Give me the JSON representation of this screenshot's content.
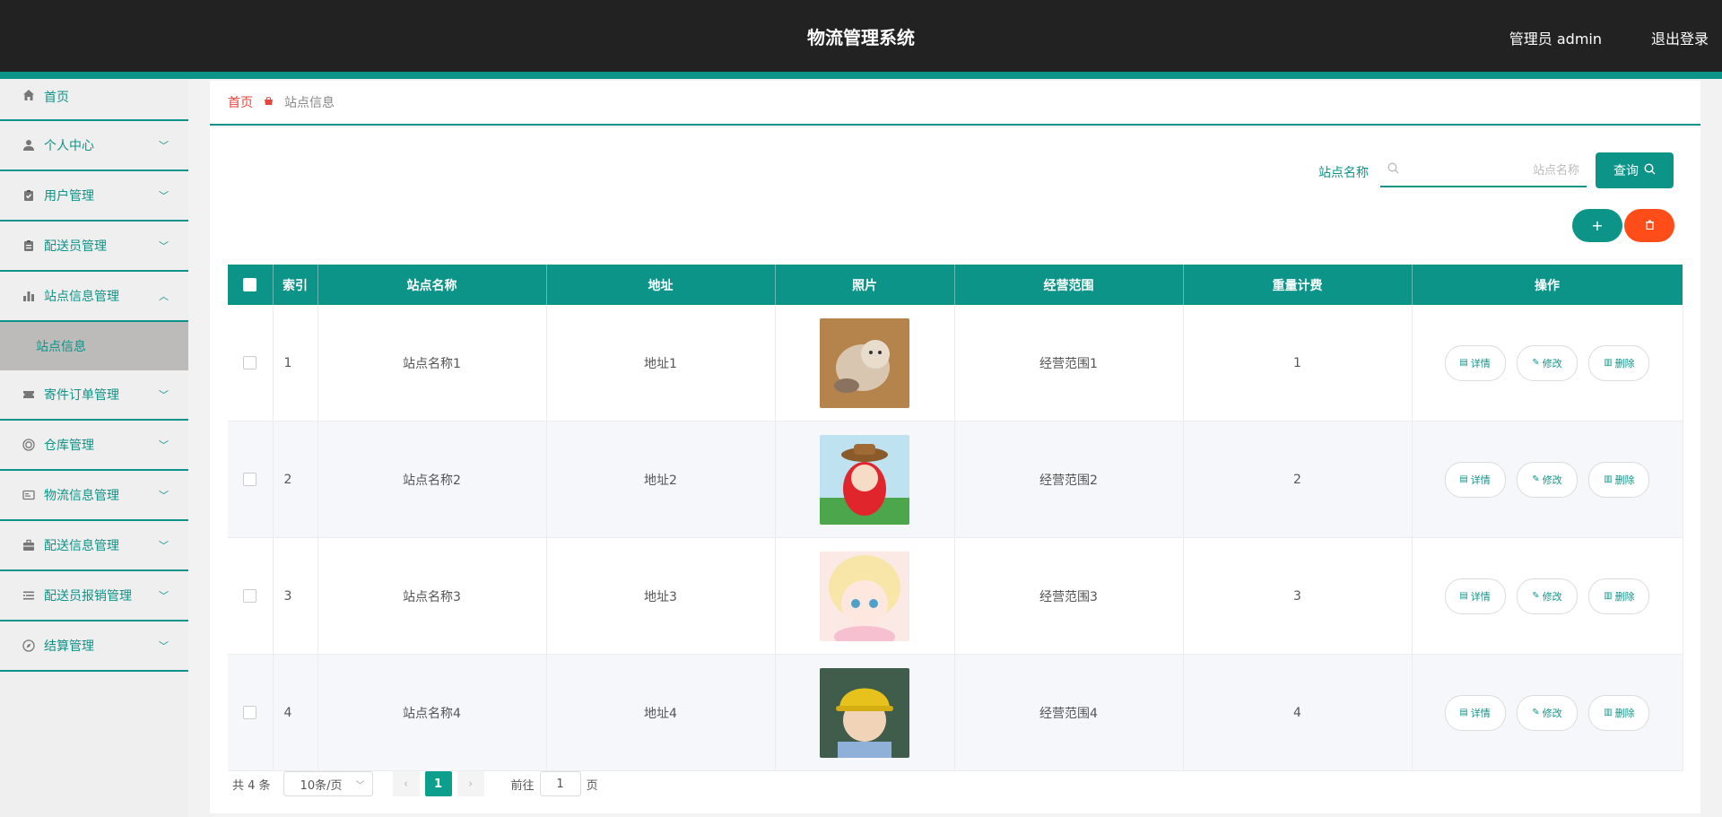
{
  "header": {
    "title": "物流管理系统",
    "user": "管理员 admin",
    "logout": "退出登录"
  },
  "sidebar": {
    "items": [
      {
        "label": "首页",
        "icon": "home-icon"
      },
      {
        "label": "个人中心",
        "icon": "user-icon"
      },
      {
        "label": "用户管理",
        "icon": "clipboard-check-icon"
      },
      {
        "label": "配送员管理",
        "icon": "clipboard-icon"
      },
      {
        "label": "站点信息管理",
        "icon": "bar-chart-icon"
      },
      {
        "label": "寄件订单管理",
        "icon": "ticket-icon"
      },
      {
        "label": "仓库管理",
        "icon": "target-icon"
      },
      {
        "label": "物流信息管理",
        "icon": "postcard-icon"
      },
      {
        "label": "配送信息管理",
        "icon": "briefcase-icon"
      },
      {
        "label": "配送员报销管理",
        "icon": "list-icon"
      },
      {
        "label": "结算管理",
        "icon": "compass-icon"
      }
    ],
    "sub_item": "站点信息"
  },
  "breadcrumb": {
    "home": "首页",
    "current": "站点信息"
  },
  "search": {
    "label": "站点名称",
    "placeholder": "站点名称",
    "query_label": "查询"
  },
  "actions": {
    "add_symbol": "+"
  },
  "table": {
    "headers": [
      "索引",
      "站点名称",
      "地址",
      "照片",
      "经营范围",
      "重量计费",
      "操作"
    ],
    "rows": [
      {
        "index": "1",
        "name": "站点名称1",
        "address": "地址1",
        "scope": "经营范围1",
        "fee": "1"
      },
      {
        "index": "2",
        "name": "站点名称2",
        "address": "地址2",
        "scope": "经营范围2",
        "fee": "2"
      },
      {
        "index": "3",
        "name": "站点名称3",
        "address": "地址3",
        "scope": "经营范围3",
        "fee": "3"
      },
      {
        "index": "4",
        "name": "站点名称4",
        "address": "地址4",
        "scope": "经营范围4",
        "fee": "4"
      }
    ],
    "op_labels": {
      "detail": "详情",
      "edit": "修改",
      "delete": "删除"
    }
  },
  "pagination": {
    "total": "共 4 条",
    "page_size": "10条/页",
    "current_page": "1",
    "goto_label": "前往",
    "goto_value": "1",
    "page_unit": "页"
  },
  "colors": {
    "primary": "#0d9488",
    "danger": "#ff4d1a",
    "header_bg": "#222222"
  }
}
